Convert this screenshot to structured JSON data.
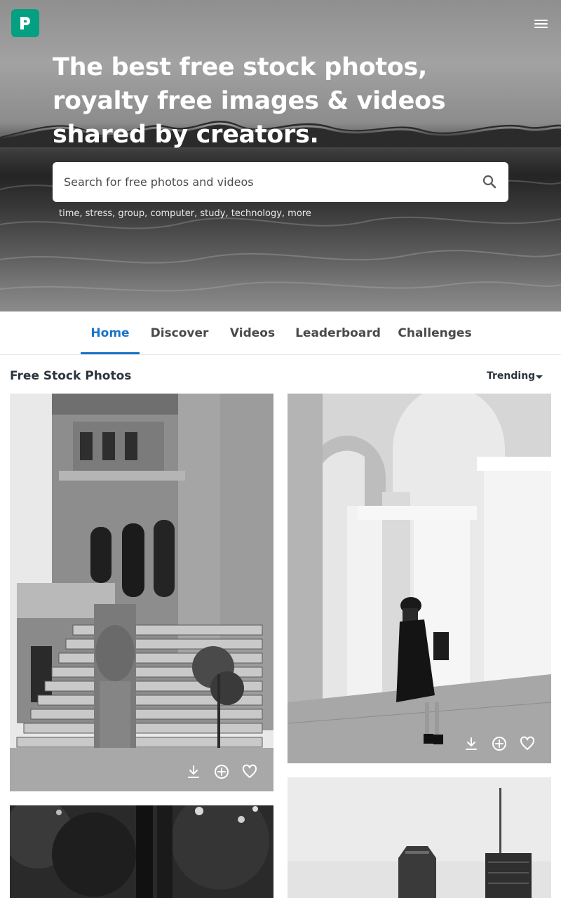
{
  "header": {
    "logo_letter": "P",
    "brand_color": "#05a081"
  },
  "hero": {
    "title": "The best free stock photos, royalty free images & videos shared by creators.",
    "search": {
      "placeholder": "Search for free photos and videos",
      "value": ""
    },
    "suggestions": [
      "time",
      "stress",
      "group",
      "computer",
      "study",
      "technology",
      "more"
    ]
  },
  "tabs": [
    {
      "label": "Home",
      "active": true
    },
    {
      "label": "Discover",
      "active": false
    },
    {
      "label": "Videos",
      "active": false
    },
    {
      "label": "Leaderboard",
      "active": false
    },
    {
      "label": "Challenges",
      "active": false
    }
  ],
  "section": {
    "title": "Free Stock Photos",
    "sort": "Trending"
  },
  "icons": {
    "menu": "menu-icon",
    "search": "search-icon",
    "download": "download-icon",
    "collect": "add-to-collection-icon",
    "like": "heart-icon"
  },
  "colors": {
    "accent": "#1a73c8",
    "brand": "#05a081"
  }
}
